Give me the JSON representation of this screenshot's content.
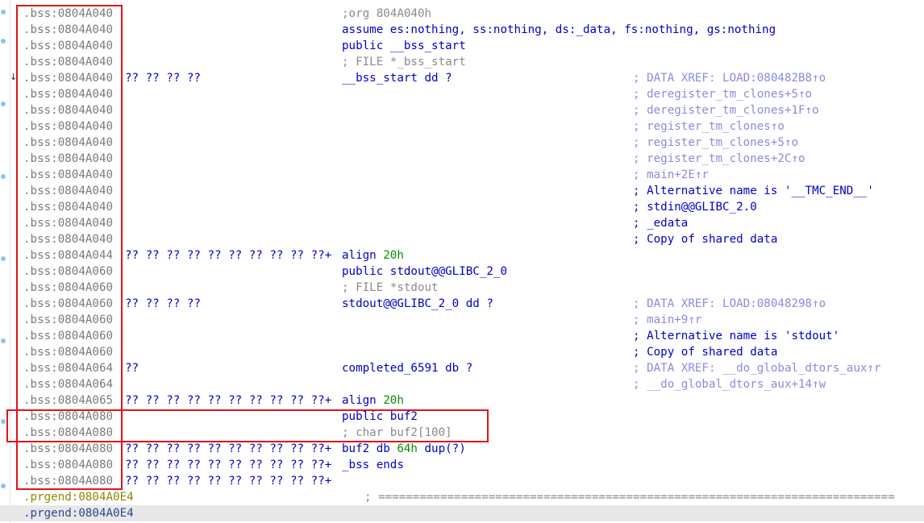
{
  "gutter": {
    "xref_arrow_icon": "down-arrow-icon"
  },
  "colors": {
    "address": "#7a7a7a",
    "instruction": "#0000c8",
    "number": "#0a8a0a",
    "comment": "#8a8a8a",
    "xref": "#8a8ae0",
    "highlight_box": "#e0141c"
  },
  "listing": {
    "rows": [
      {
        "addr": ".bss:0804A040",
        "bytes": "",
        "instr": ";org 804A040h",
        "comment": ""
      },
      {
        "addr": ".bss:0804A040",
        "bytes": "",
        "instr": "assume es:nothing, ss:nothing, ds:_data, fs:nothing, gs:nothing",
        "comment": ""
      },
      {
        "addr": ".bss:0804A040",
        "bytes": "",
        "instr": "public __bss_start",
        "comment": ""
      },
      {
        "addr": ".bss:0804A040",
        "bytes": "",
        "instr": "; FILE *_bss_start",
        "comment": ""
      },
      {
        "addr": ".bss:0804A040",
        "bytes": "?? ?? ?? ??",
        "instr": "__bss_start dd ?",
        "comment": "; DATA XREF: LOAD:080482B8↑o"
      },
      {
        "addr": ".bss:0804A040",
        "bytes": "",
        "instr": "",
        "comment": "; deregister_tm_clones+5↑o"
      },
      {
        "addr": ".bss:0804A040",
        "bytes": "",
        "instr": "",
        "comment": "; deregister_tm_clones+1F↑o"
      },
      {
        "addr": ".bss:0804A040",
        "bytes": "",
        "instr": "",
        "comment": "; register_tm_clones↑o"
      },
      {
        "addr": ".bss:0804A040",
        "bytes": "",
        "instr": "",
        "comment": "; register_tm_clones+5↑o"
      },
      {
        "addr": ".bss:0804A040",
        "bytes": "",
        "instr": "",
        "comment": "; register_tm_clones+2C↑o"
      },
      {
        "addr": ".bss:0804A040",
        "bytes": "",
        "instr": "",
        "comment": "; main+2E↑r"
      },
      {
        "addr": ".bss:0804A040",
        "bytes": "",
        "instr": "",
        "comment": "; Alternative name is '__TMC_END__'"
      },
      {
        "addr": ".bss:0804A040",
        "bytes": "",
        "instr": "",
        "comment": "; stdin@@GLIBC_2.0"
      },
      {
        "addr": ".bss:0804A040",
        "bytes": "",
        "instr": "",
        "comment": "; _edata"
      },
      {
        "addr": ".bss:0804A040",
        "bytes": "",
        "instr": "",
        "comment": "; Copy of shared data"
      },
      {
        "addr": ".bss:0804A044",
        "bytes": "?? ?? ?? ?? ?? ?? ?? ?? ?? ??+",
        "instr": "align 20h",
        "comment": ""
      },
      {
        "addr": ".bss:0804A060",
        "bytes": "",
        "instr": "public stdout@@GLIBC_2_0",
        "comment": ""
      },
      {
        "addr": ".bss:0804A060",
        "bytes": "",
        "instr": "; FILE *stdout",
        "comment": ""
      },
      {
        "addr": ".bss:0804A060",
        "bytes": "?? ?? ?? ??",
        "instr": "stdout@@GLIBC_2_0 dd ?",
        "comment": "; DATA XREF: LOAD:08048298↑o"
      },
      {
        "addr": ".bss:0804A060",
        "bytes": "",
        "instr": "",
        "comment": "; main+9↑r"
      },
      {
        "addr": ".bss:0804A060",
        "bytes": "",
        "instr": "",
        "comment": "; Alternative name is 'stdout'"
      },
      {
        "addr": ".bss:0804A060",
        "bytes": "",
        "instr": "",
        "comment": "; Copy of shared data"
      },
      {
        "addr": ".bss:0804A064",
        "bytes": "??",
        "instr": "completed_6591 db ?",
        "comment": "; DATA XREF: __do_global_dtors_aux↑r"
      },
      {
        "addr": ".bss:0804A064",
        "bytes": "",
        "instr": "",
        "comment": "; __do_global_dtors_aux+14↑w"
      },
      {
        "addr": ".bss:0804A065",
        "bytes": "?? ?? ?? ?? ?? ?? ?? ?? ?? ??+",
        "instr": "align 20h",
        "comment": ""
      },
      {
        "addr": ".bss:0804A080",
        "bytes": "",
        "instr": "public buf2",
        "comment": ""
      },
      {
        "addr": ".bss:0804A080",
        "bytes": "",
        "instr": "; char buf2[100]",
        "comment": ""
      },
      {
        "addr": ".bss:0804A080",
        "bytes": "?? ?? ?? ?? ?? ?? ?? ?? ?? ??+",
        "instr": "buf2 db 64h dup(?)",
        "comment": ""
      },
      {
        "addr": ".bss:0804A080",
        "bytes": "?? ?? ?? ?? ?? ?? ?? ?? ?? ??+",
        "instr": "_bss ends",
        "comment": ""
      },
      {
        "addr": ".bss:0804A080",
        "bytes": "?? ?? ?? ?? ?? ?? ?? ?? ?? ??+",
        "instr": "",
        "comment": ""
      },
      {
        "addr": ".prgend:0804A0E4",
        "bytes": "",
        "instr": "",
        "comment": "",
        "separator": "; ==========================================================================="
      },
      {
        "addr": ".prgend:0804A0E4",
        "bytes": "",
        "instr": "",
        "comment": ""
      }
    ]
  }
}
